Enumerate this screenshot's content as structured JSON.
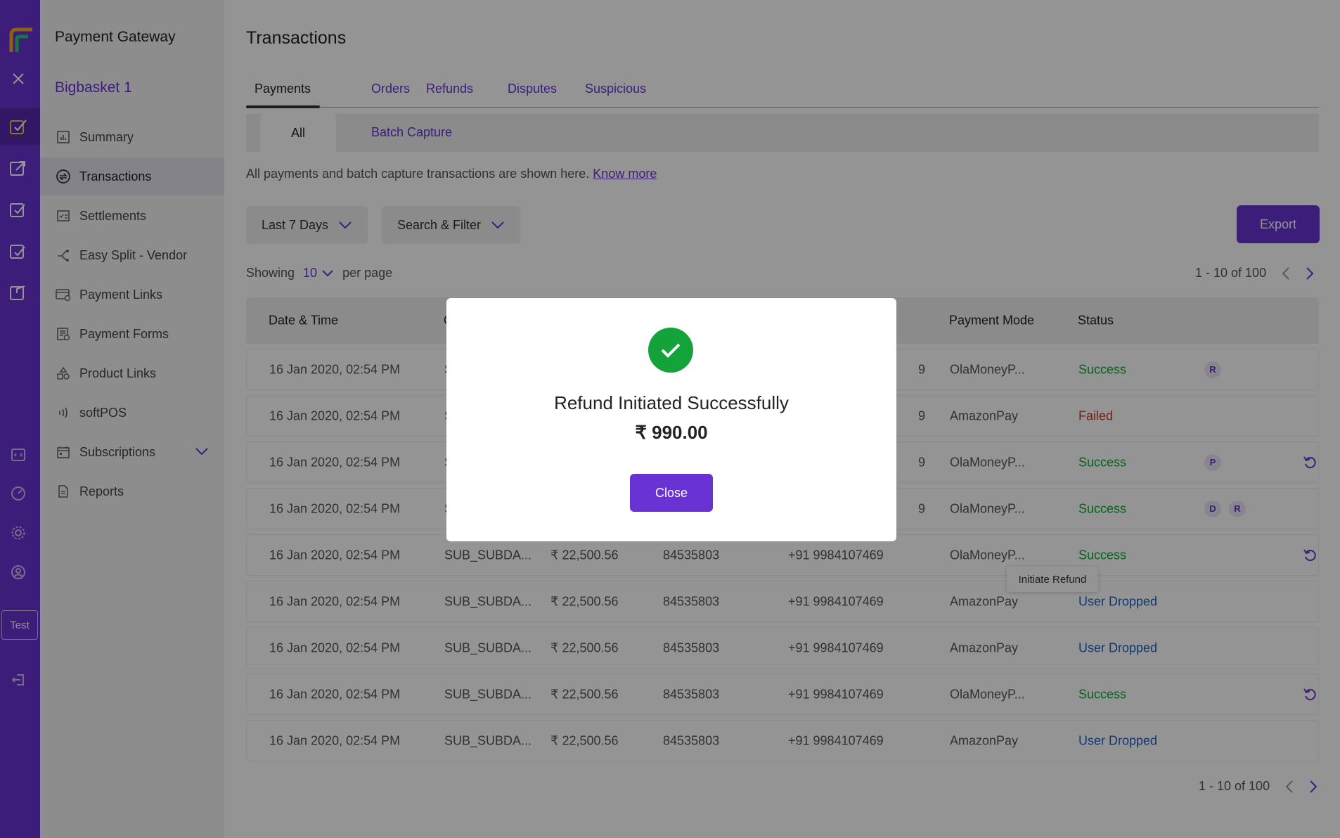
{
  "colors": {
    "brand": "#6933d3",
    "success": "#14a33a",
    "failed": "#c0392b",
    "user_dropped": "#1f5fb8"
  },
  "rail": {
    "test_label": "Test"
  },
  "sidebar": {
    "brand": "Payment Gateway",
    "merchant": "Bigbasket 1",
    "items": [
      {
        "label": "Summary",
        "icon": "bar-chart-icon"
      },
      {
        "label": "Transactions",
        "icon": "transactions-icon"
      },
      {
        "label": "Settlements",
        "icon": "settlements-icon"
      },
      {
        "label": "Easy Split -  Vendor",
        "icon": "split-icon"
      },
      {
        "label": "Payment Links",
        "icon": "link-card-icon"
      },
      {
        "label": "Payment Forms",
        "icon": "form-icon"
      },
      {
        "label": "Product Links",
        "icon": "shapes-icon"
      },
      {
        "label": "softPOS",
        "icon": "contactless-icon"
      },
      {
        "label": "Subscriptions",
        "icon": "calendar-icon"
      },
      {
        "label": "Reports",
        "icon": "document-icon"
      }
    ]
  },
  "main": {
    "title": "Transactions",
    "tabs": [
      "Payments",
      "Orders",
      "Refunds",
      "Disputes",
      "Suspicious"
    ],
    "subtabs": [
      "All",
      "Batch Capture"
    ],
    "info_text": "All payments and batch capture transactions are shown here.",
    "info_link": "Know more",
    "date_filter": "Last 7 Days",
    "search_filter": "Search & Filter",
    "export_label": "Export",
    "showing_label": "Showing",
    "per_page_value": "10",
    "per_page_label": "per page",
    "pager_text": "1 - 10 of 100"
  },
  "table": {
    "headers": {
      "datetime": "Date & Time",
      "id_prefix": "O",
      "payment_mode": "Payment Mode",
      "status": "Status"
    },
    "rows": [
      {
        "datetime": "16 Jan 2020, 02:54 PM",
        "id": "S",
        "amount": "",
        "order": "",
        "phone_tail": "9",
        "mode": "OlaMoneyP...",
        "status": "Success",
        "status_type": "success",
        "badges": [
          "R"
        ],
        "refund": false
      },
      {
        "datetime": "16 Jan 2020, 02:54 PM",
        "id": "S",
        "amount": "",
        "order": "",
        "phone_tail": "9",
        "mode": "AmazonPay",
        "status": "Failed",
        "status_type": "failed",
        "badges": [],
        "refund": false
      },
      {
        "datetime": "16 Jan 2020, 02:54 PM",
        "id": "S",
        "amount": "",
        "order": "",
        "phone_tail": "9",
        "mode": "OlaMoneyP...",
        "status": "Success",
        "status_type": "success",
        "badges": [
          "P"
        ],
        "refund": true
      },
      {
        "datetime": "16 Jan 2020, 02:54 PM",
        "id": "S",
        "amount": "",
        "order": "",
        "phone_tail": "9",
        "mode": "OlaMoneyP...",
        "status": "Success",
        "status_type": "success",
        "badges": [
          "D",
          "R"
        ],
        "refund": false
      },
      {
        "datetime": "16 Jan 2020, 02:54 PM",
        "id": "SUB_SUBDA...",
        "amount": "₹ 22,500.56",
        "order": "84535803",
        "phone": "+91 9984107469",
        "mode": "OlaMoneyP...",
        "status": "Success",
        "status_type": "success",
        "badges": [],
        "refund": true
      },
      {
        "datetime": "16 Jan 2020, 02:54 PM",
        "id": "SUB_SUBDA...",
        "amount": "₹ 22,500.56",
        "order": "84535803",
        "phone": "+91 9984107469",
        "mode": "AmazonPay",
        "status": "User Dropped",
        "status_type": "user_dropped",
        "badges": [],
        "refund": false
      },
      {
        "datetime": "16 Jan 2020, 02:54 PM",
        "id": "SUB_SUBDA...",
        "amount": "₹ 22,500.56",
        "order": "84535803",
        "phone": "+91 9984107469",
        "mode": "AmazonPay",
        "status": "User Dropped",
        "status_type": "user_dropped",
        "badges": [],
        "refund": false
      },
      {
        "datetime": "16 Jan 2020, 02:54 PM",
        "id": "SUB_SUBDA...",
        "amount": "₹ 22,500.56",
        "order": "84535803",
        "phone": "+91 9984107469",
        "mode": "OlaMoneyP...",
        "status": "Success",
        "status_type": "success",
        "badges": [],
        "refund": true
      },
      {
        "datetime": "16 Jan 2020, 02:54 PM",
        "id": "SUB_SUBDA...",
        "amount": "₹ 22,500.56",
        "order": "84535803",
        "phone": "+91 9984107469",
        "mode": "AmazonPay",
        "status": "User Dropped",
        "status_type": "user_dropped",
        "badges": [],
        "refund": false
      }
    ],
    "tooltip": "Initiate Refund"
  },
  "modal": {
    "message": "Refund Initiated Successfully",
    "amount": "₹ 990.00",
    "close_label": "Close"
  }
}
